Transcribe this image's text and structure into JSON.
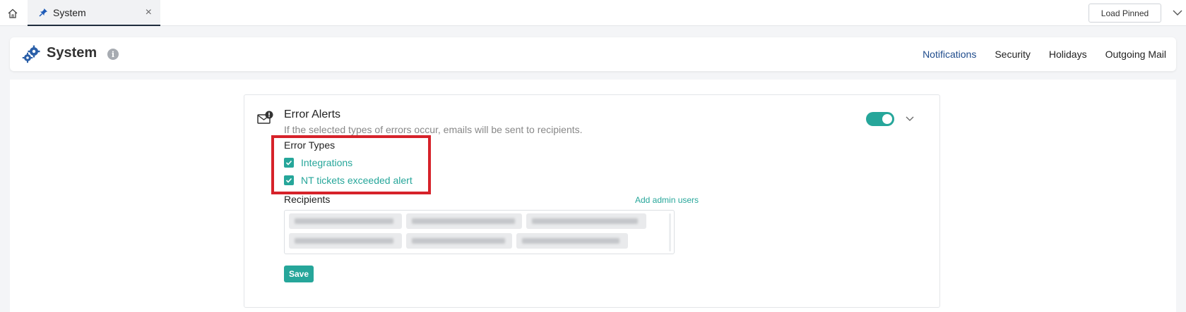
{
  "tabbar": {
    "tab_label": "System",
    "load_pinned_label": "Load Pinned",
    "close_symbol": "×"
  },
  "header": {
    "title": "System",
    "info_symbol": "i",
    "nav": [
      {
        "label": "Notifications",
        "active": true
      },
      {
        "label": "Security",
        "active": false
      },
      {
        "label": "Holidays",
        "active": false
      },
      {
        "label": "Outgoing Mail",
        "active": false
      }
    ]
  },
  "card": {
    "title": "Error Alerts",
    "description": "If the selected types of errors occur, emails will be sent to recipients.",
    "enabled": true,
    "error_types_label": "Error Types",
    "error_types": [
      {
        "label": "Integrations",
        "checked": true
      },
      {
        "label": "NT tickets exceeded alert",
        "checked": true
      }
    ],
    "recipients_label": "Recipients",
    "add_admin_label": "Add admin users",
    "save_label": "Save"
  },
  "colors": {
    "accent": "#26a69a",
    "nav_active": "#1e4b8c",
    "highlight_border": "#d6222a"
  },
  "icons": [
    "home-icon",
    "pin-icon",
    "close-icon",
    "chevron-down-icon",
    "gears-icon",
    "info-icon",
    "mail-alert-icon",
    "check-icon"
  ]
}
